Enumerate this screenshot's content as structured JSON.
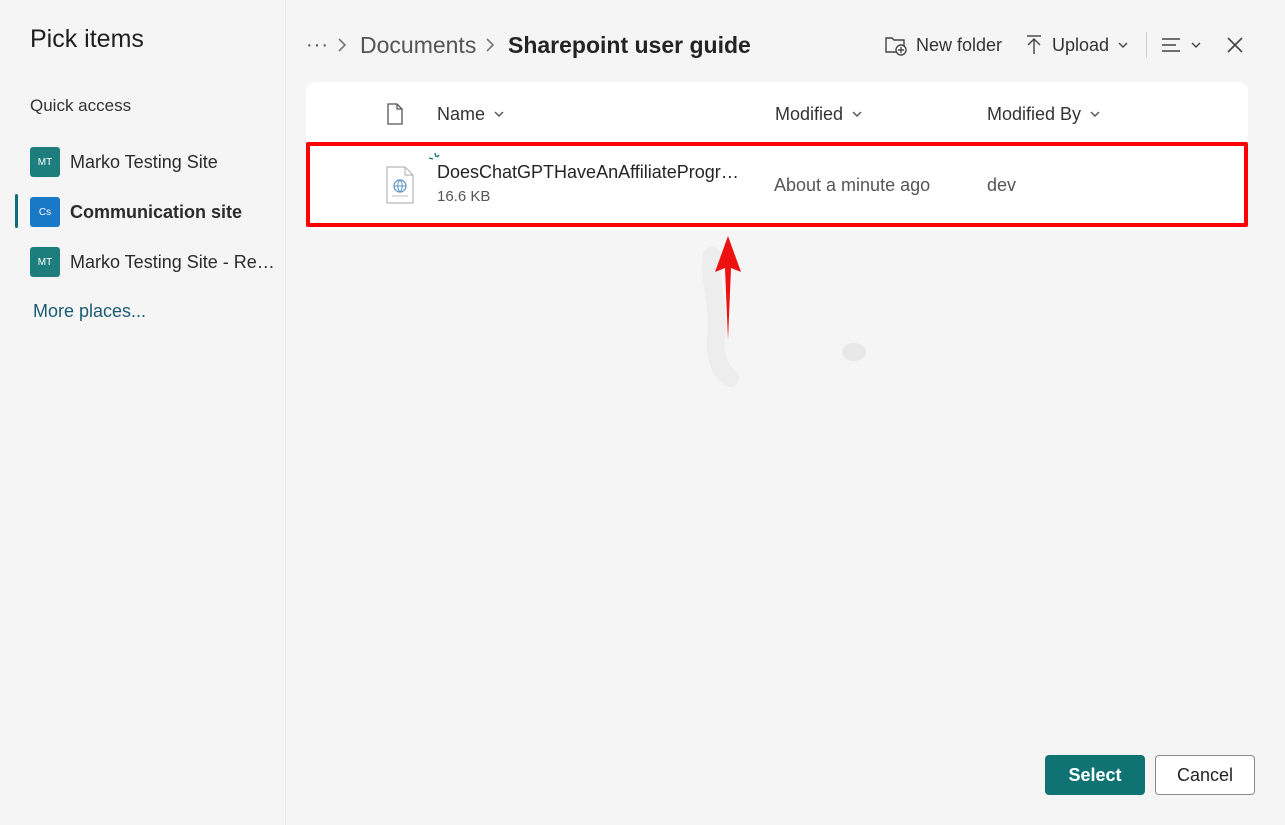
{
  "sidebar": {
    "title": "Pick items",
    "section_label": "Quick access",
    "sites": [
      {
        "abbr": "MT",
        "label": "Marko Testing Site",
        "color": "#1e7e7e"
      },
      {
        "abbr": "Cs",
        "label": "Communication site",
        "color": "#1a78c8"
      },
      {
        "abbr": "MT",
        "label": "Marko Testing Site - Retention",
        "color": "#1e7e7e"
      }
    ],
    "more_places": "More places..."
  },
  "breadcrumb": {
    "overflow": "···",
    "separator": ">",
    "parent": "Documents",
    "current": "Sharepoint user guide"
  },
  "toolbar": {
    "new_folder": "New folder",
    "upload": "Upload"
  },
  "columns": {
    "name": "Name",
    "modified": "Modified",
    "modified_by": "Modified By"
  },
  "files": [
    {
      "name": "DoesChatGPTHaveAnAffiliateProgram...",
      "size": "16.6 KB",
      "modified": "About a minute ago",
      "modified_by": "dev"
    }
  ],
  "footer": {
    "select": "Select",
    "cancel": "Cancel"
  },
  "colors": {
    "accent": "#0f7373",
    "highlight": "#ff0000"
  }
}
